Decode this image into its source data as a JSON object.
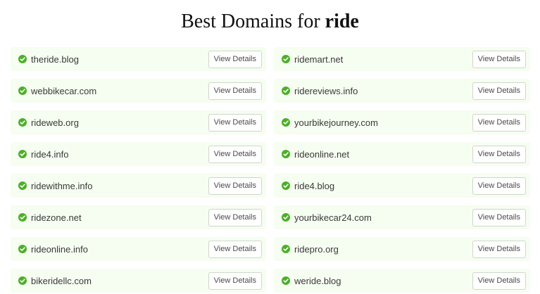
{
  "header": {
    "title_prefix": "Best Domains for",
    "keyword": "ride"
  },
  "colors": {
    "card_bg": "#f6fdf1",
    "check_green": "#4caf28",
    "button_border": "#cfd8c9"
  },
  "icons": {
    "available": "check-circle-icon"
  },
  "button_label": "View Details",
  "domains": [
    {
      "name": "theride.blog",
      "button": "View Details"
    },
    {
      "name": "ridemart.net",
      "button": "View Details"
    },
    {
      "name": "webbikecar.com",
      "button": "View Details"
    },
    {
      "name": "ridereviews.info",
      "button": "View Details"
    },
    {
      "name": "rideweb.org",
      "button": "View Details"
    },
    {
      "name": "yourbikejourney.com",
      "button": "View Details"
    },
    {
      "name": "ride4.info",
      "button": "View Details"
    },
    {
      "name": "rideonline.net",
      "button": "View Details"
    },
    {
      "name": "ridewithme.info",
      "button": "View Details"
    },
    {
      "name": "ride4.blog",
      "button": "View Details"
    },
    {
      "name": "ridezone.net",
      "button": "View Details"
    },
    {
      "name": "yourbikecar24.com",
      "button": "View Details"
    },
    {
      "name": "rideonline.info",
      "button": "View Details"
    },
    {
      "name": "ridepro.org",
      "button": "View Details"
    },
    {
      "name": "bikeridellc.com",
      "button": "View Details"
    },
    {
      "name": "weride.blog",
      "button": "View Details"
    }
  ]
}
